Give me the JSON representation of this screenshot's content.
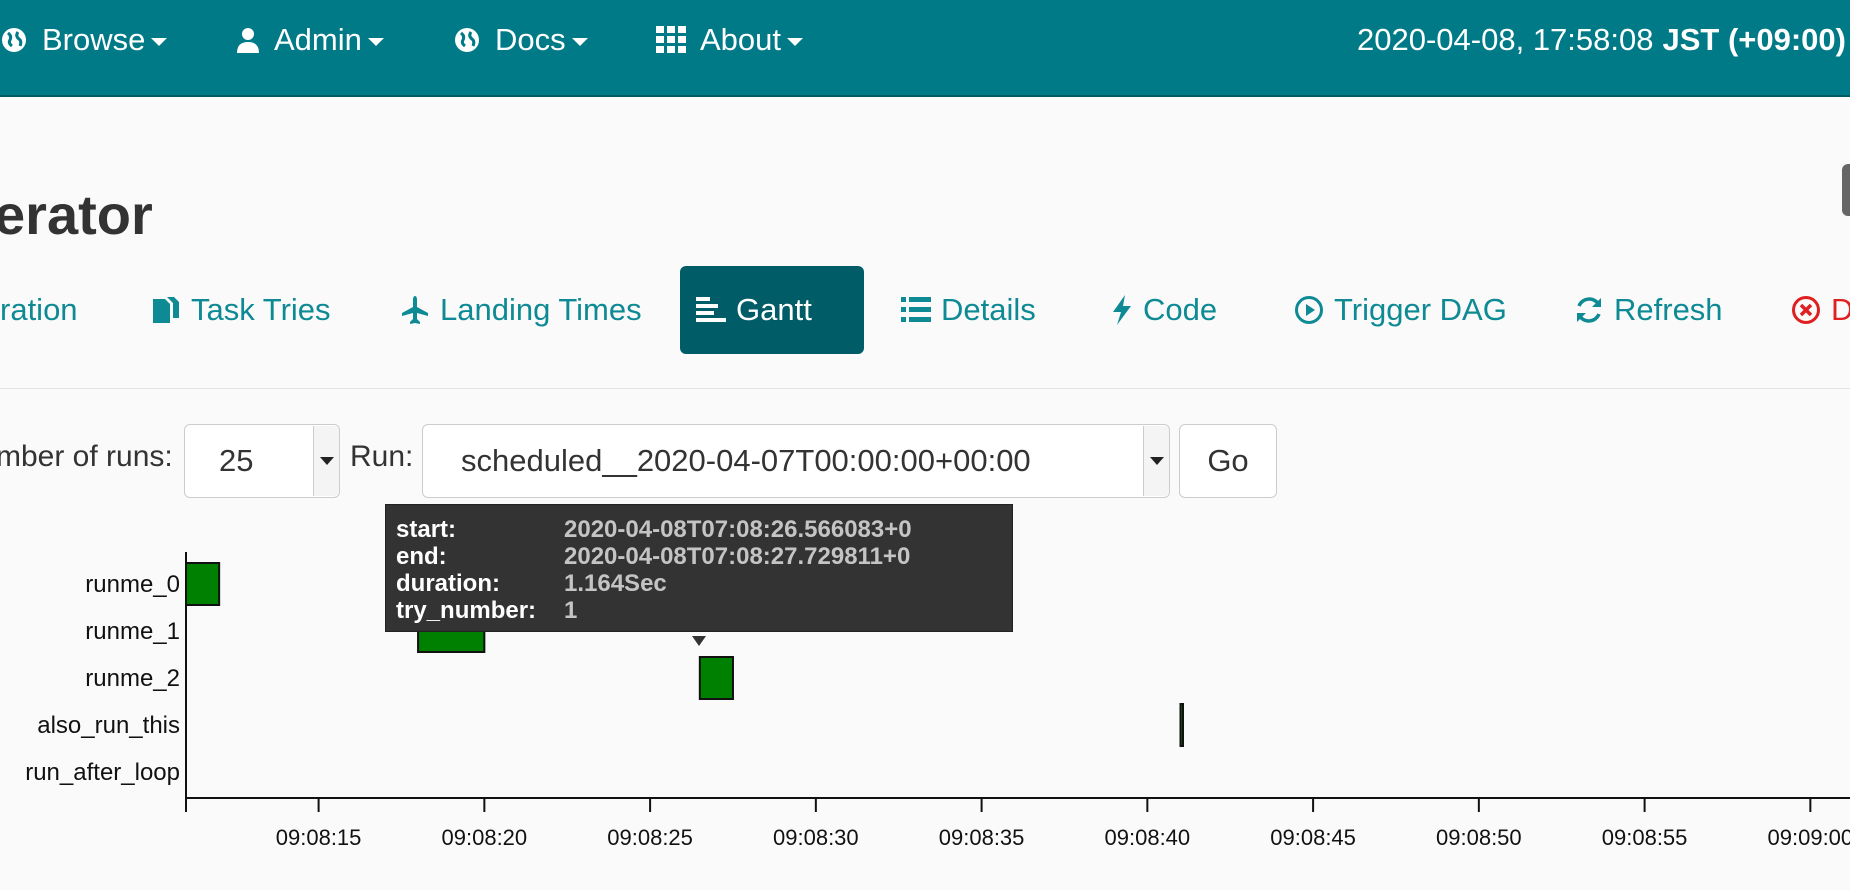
{
  "navbar": {
    "items": [
      {
        "label": "Browse",
        "icon": "globe-icon"
      },
      {
        "label": "Admin",
        "icon": "user-icon"
      },
      {
        "label": "Docs",
        "icon": "globe-icon"
      },
      {
        "label": "About",
        "icon": "grid-icon"
      }
    ],
    "clock": {
      "datetime": "2020-04-08, 17:58:08",
      "timezone": "JST (+09:00)"
    }
  },
  "page": {
    "title": "erator"
  },
  "tabs": [
    {
      "label": "ration",
      "icon": ""
    },
    {
      "label": "Task Tries",
      "icon": "files-icon"
    },
    {
      "label": "Landing Times",
      "icon": "plane-icon"
    },
    {
      "label": "Gantt",
      "icon": "gantt-icon",
      "active": true
    },
    {
      "label": "Details",
      "icon": "list-icon"
    },
    {
      "label": "Code",
      "icon": "bolt-icon"
    },
    {
      "label": "Trigger DAG",
      "icon": "play-circle-icon"
    },
    {
      "label": "Refresh",
      "icon": "refresh-icon"
    },
    {
      "label": "D",
      "icon": "delete-circle-icon"
    }
  ],
  "controls": {
    "runs_label": "mber of runs:",
    "runs_value": "25",
    "run_label": "Run:",
    "run_value": "scheduled__2020-04-07T00:00:00+00:00",
    "go_label": "Go"
  },
  "chart_data": {
    "type": "gantt",
    "tasks": [
      "runme_0",
      "runme_1",
      "runme_2",
      "also_run_this",
      "run_after_loop"
    ],
    "bars": [
      {
        "task": "runme_0",
        "start": "09:08:11.0",
        "end": "09:08:12.0",
        "state": "success"
      },
      {
        "task": "runme_1",
        "start": "09:08:18.0",
        "end": "09:08:20.0",
        "state": "success"
      },
      {
        "task": "runme_2",
        "start": "09:08:26.5",
        "end": "09:08:27.5",
        "state": "success"
      },
      {
        "task": "also_run_this",
        "start": "09:08:41.0",
        "end": "09:08:41.05",
        "state": "success"
      }
    ],
    "x_ticks": [
      "09:08:15",
      "09:08:20",
      "09:08:25",
      "09:08:30",
      "09:08:35",
      "09:08:40",
      "09:08:45",
      "09:08:50",
      "09:08:55",
      "09:09:00"
    ],
    "xlim": [
      "09:08:11",
      "09:09:00"
    ],
    "colors": {
      "success": "#008000",
      "border": "#111111"
    }
  },
  "tooltip": {
    "rows": [
      {
        "key": "start:",
        "value": "2020-04-08T07:08:26.566083+0"
      },
      {
        "key": "end:",
        "value": "2020-04-08T07:08:27.729811+0"
      },
      {
        "key": "duration:",
        "value": "1.164Sec"
      },
      {
        "key": "try_number:",
        "value": "1"
      }
    ]
  },
  "colors": {
    "navbar": "#007a87",
    "tab_active": "#005c66",
    "tab_link": "#0e8a95",
    "danger": "#e02020"
  }
}
